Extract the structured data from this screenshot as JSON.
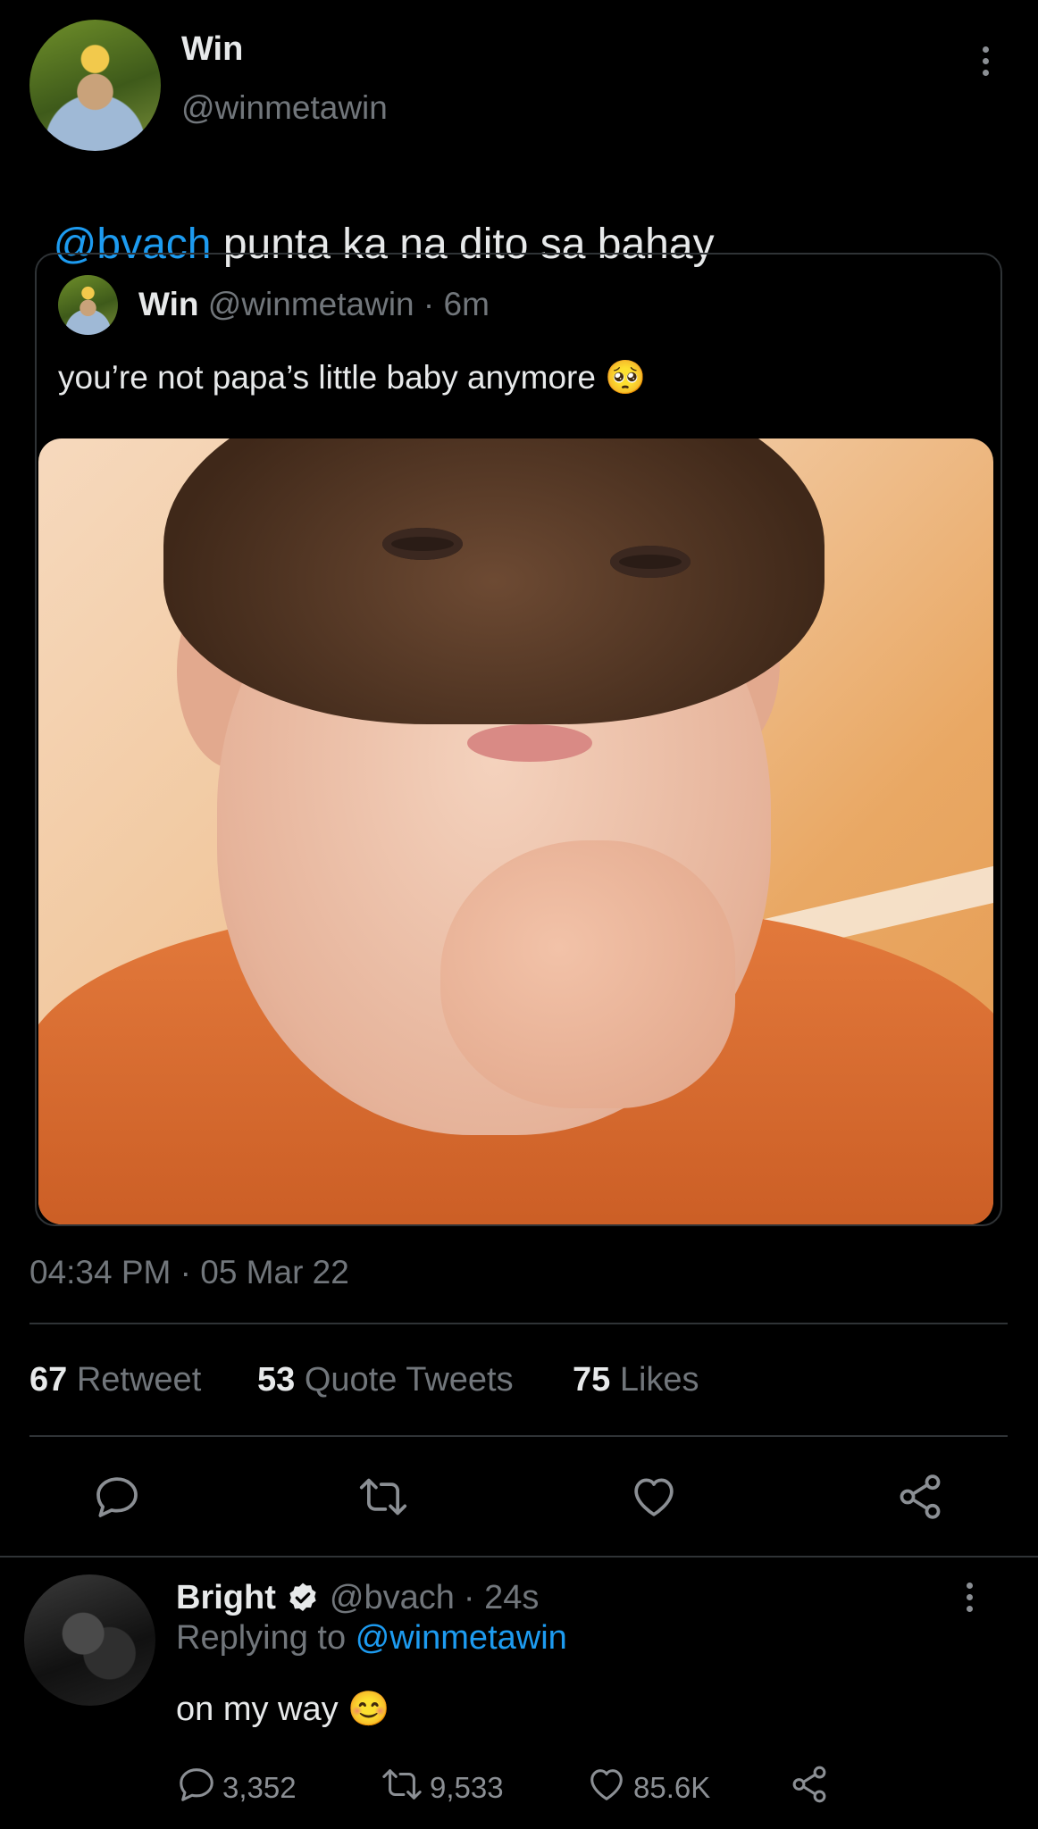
{
  "main_tweet": {
    "author_name": "Win",
    "author_handle": "@winmetawin",
    "text_mention": "@bvach",
    "text_body": " punta ka na dito sa bahay",
    "timestamp": "04:34 PM · 05 Mar 22",
    "stats": {
      "retweets_count": "67",
      "retweets_label": "Retweet",
      "quotes_count": "53",
      "quotes_label": "Quote Tweets",
      "likes_count": "75",
      "likes_label": "Likes"
    },
    "actions": [
      "reply-icon",
      "retweet-icon",
      "like-icon",
      "share-icon"
    ]
  },
  "quoted_tweet": {
    "author_name": "Win",
    "author_handle": "@winmetawin",
    "time": "· 6m",
    "text": "you’re not papa’s little baby anymore 🥺"
  },
  "reply": {
    "author_name": "Bright",
    "author_handle": "@bvach",
    "time": "· 24s",
    "replying_label": "Replying to",
    "replying_handle": "@winmetawin",
    "text": "on my way 😊",
    "reply_count": "3,352",
    "retweet_count": "9,533",
    "like_count": "85.6K"
  },
  "colors": {
    "background": "#000000",
    "accent": "#1d9bf0",
    "muted": "#71767b",
    "border": "#2f3336"
  }
}
